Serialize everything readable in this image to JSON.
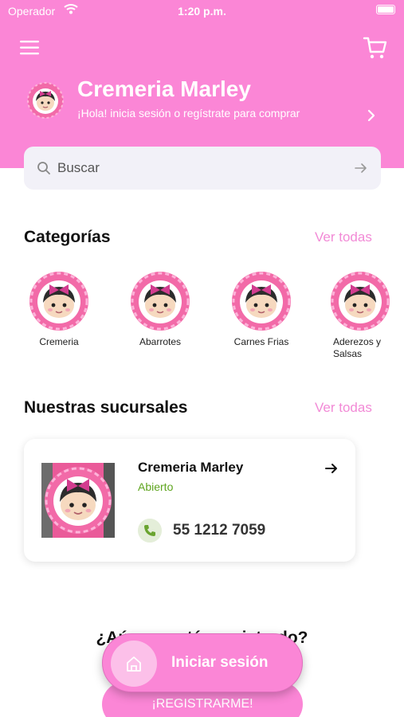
{
  "status_bar": {
    "carrier": "Operador",
    "time": "1:20 p.m."
  },
  "header": {
    "store_name": "Cremeria Marley",
    "subtitle": "¡Hola! inicia sesión o regístrate para comprar",
    "icons": [
      "menu-icon",
      "cart-icon",
      "chevron-right-icon"
    ]
  },
  "search": {
    "placeholder": "Buscar"
  },
  "categories": {
    "title": "Categorías",
    "see_all": "Ver todas",
    "items": [
      {
        "label": "Cremeria"
      },
      {
        "label": "Abarrotes"
      },
      {
        "label": "Carnes Frias"
      },
      {
        "label": "Aderezos y Salsas"
      }
    ]
  },
  "branches": {
    "title": "Nuestras sucursales",
    "see_all": "Ver todas",
    "items": [
      {
        "name": "Cremeria Marley",
        "status": "Abierto",
        "phone": "55 1212 7059"
      }
    ]
  },
  "promo": {
    "text": "¿Aún no estás registrado?"
  },
  "buttons": {
    "login": "Iniciar sesión",
    "register": "¡REGISTRARME!"
  },
  "colors": {
    "brand_pink": "#fb86d6",
    "link_pink": "#f28ad6",
    "status_green": "#5fa51f"
  }
}
